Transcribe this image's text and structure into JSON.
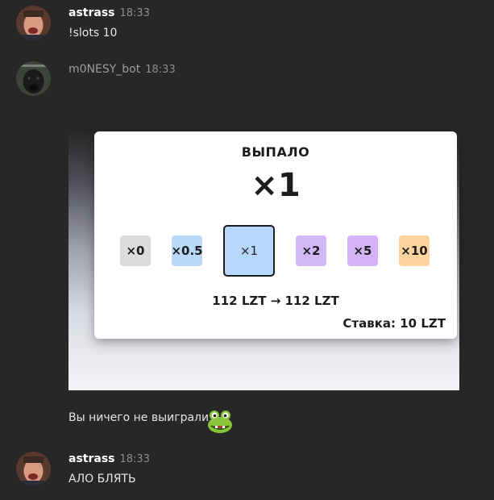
{
  "messages": [
    {
      "author": "astrass",
      "time": "18:33",
      "text": "!slots 10"
    },
    {
      "author": "m0NESY_bot",
      "time": "18:33"
    },
    {
      "author": "astrass",
      "time": "18:33",
      "text": "АЛО БЛЯТЬ"
    }
  ],
  "slots": {
    "title": "ВЫПАЛО",
    "result": "×1",
    "multipliers": [
      {
        "label": "×0",
        "color": "#dcdcdc"
      },
      {
        "label": "×0.5",
        "color": "#b9d9fb"
      },
      {
        "label": "×1",
        "color": "#b7d7fb",
        "selected": true
      },
      {
        "label": "×2",
        "color": "#d2b6f6"
      },
      {
        "label": "×5",
        "color": "#d4b4f6"
      },
      {
        "label": "×10",
        "color": "#fcd39c"
      }
    ],
    "balance": "112 LZT → 112 LZT",
    "bet": "Ставка: 10 LZT"
  },
  "bot_result_text": "Вы ничего не выиграли",
  "emoji": "frog-emoji"
}
